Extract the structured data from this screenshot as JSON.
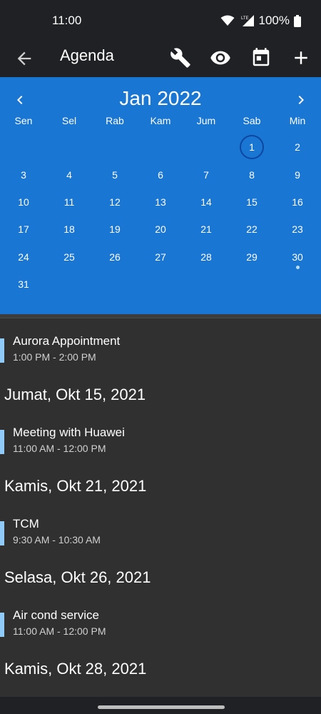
{
  "status": {
    "time": "11:00",
    "battery": "100%",
    "network": "LTE"
  },
  "appbar": {
    "title": "Agenda",
    "icons": [
      "back-arrow-icon",
      "wrench-icon",
      "eye-icon",
      "calendar-icon",
      "plus-icon"
    ]
  },
  "colors": {
    "accent": "#1976d2",
    "event_bar": "#90caf9",
    "background": "#303030",
    "toolbar": "#202124"
  },
  "calendar": {
    "month_label": "Jan 2022",
    "weekdays": [
      "Sen",
      "Sel",
      "Rab",
      "Kam",
      "Jum",
      "Sab",
      "Min"
    ],
    "days": [
      "1",
      "2",
      "3",
      "4",
      "5",
      "6",
      "7",
      "8",
      "9",
      "10",
      "11",
      "12",
      "13",
      "14",
      "15",
      "16",
      "17",
      "18",
      "19",
      "20",
      "21",
      "22",
      "23",
      "24",
      "25",
      "26",
      "27",
      "28",
      "29",
      "30",
      "31"
    ],
    "first_weekday_index": 5,
    "today": "1",
    "days_with_events": [
      "30"
    ]
  },
  "agenda": [
    {
      "type": "event",
      "title": "Aurora Appointment",
      "time": "1:00 PM - 2:00 PM"
    },
    {
      "type": "header",
      "label": "Jumat, Okt 15, 2021"
    },
    {
      "type": "event",
      "title": "Meeting with Huawei",
      "time": "11:00 AM - 12:00 PM"
    },
    {
      "type": "header",
      "label": "Kamis, Okt 21, 2021"
    },
    {
      "type": "event",
      "title": "TCM",
      "time": "9:30 AM - 10:30 AM"
    },
    {
      "type": "header",
      "label": "Selasa, Okt 26, 2021"
    },
    {
      "type": "event",
      "title": "Air cond service",
      "time": "11:00 AM - 12:00 PM"
    },
    {
      "type": "header",
      "label": "Kamis, Okt 28, 2021"
    }
  ]
}
